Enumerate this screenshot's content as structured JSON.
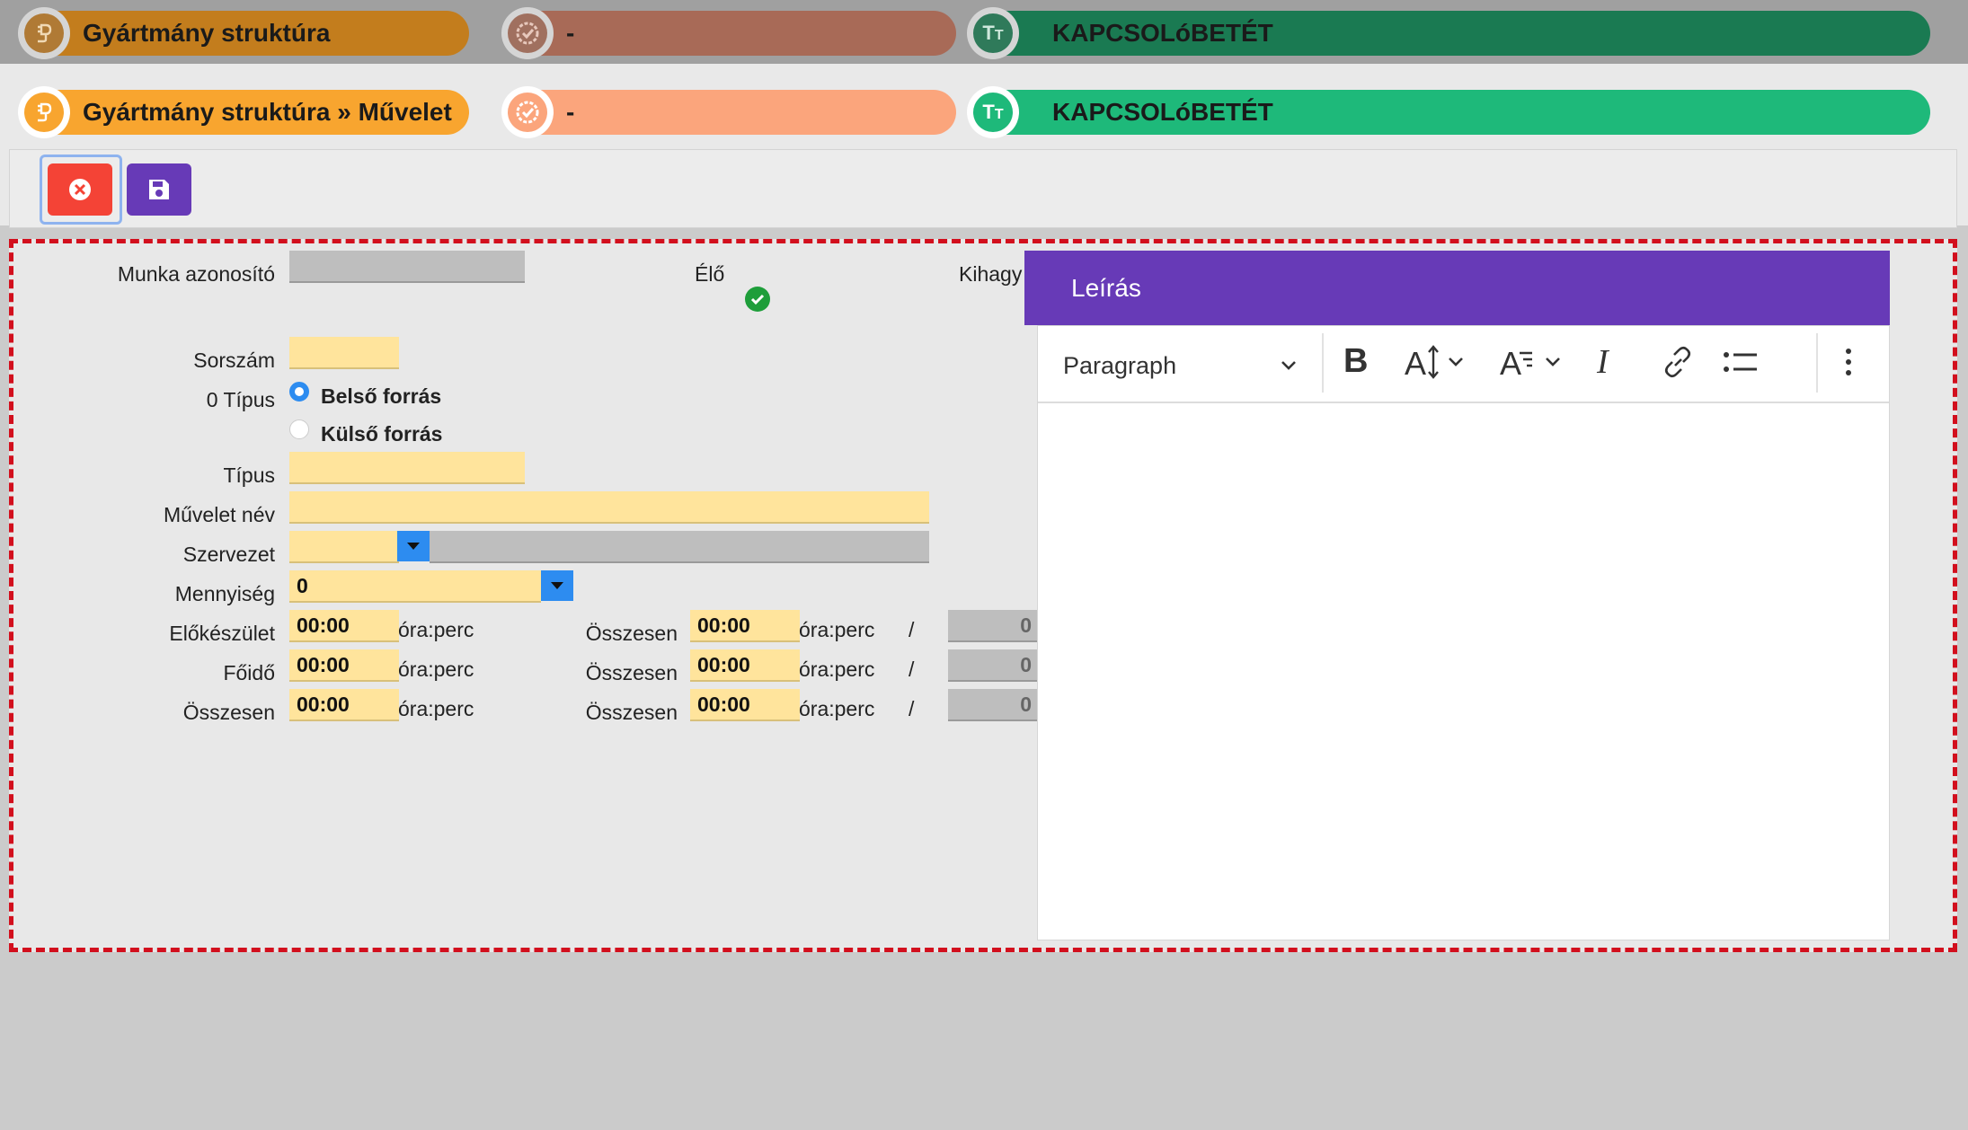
{
  "breadcrumb_top": [
    {
      "label": "Gyártmány struktúra",
      "icon": "plug-icon",
      "color": "#c37d1d"
    },
    {
      "label": "-",
      "icon": "check-badge-icon",
      "color": "#a86a57"
    },
    {
      "label": "KAPCSOLóBETÉT",
      "icon": "text-size-icon",
      "color": "#1a7a52"
    }
  ],
  "breadcrumb_main": [
    {
      "label": "Gyártmány struktúra » Művelet",
      "icon": "plug-icon",
      "color": "#f8a52f"
    },
    {
      "label": "-",
      "icon": "check-badge-icon",
      "color": "#fba57c"
    },
    {
      "label": "KAPCSOLóBETÉT",
      "icon": "text-size-icon",
      "color": "#1eb97a"
    }
  ],
  "toolbar": {
    "close_icon": "close-circle-icon",
    "save_icon": "floppy-disk-icon"
  },
  "form": {
    "munka_azonosito_label": "Munka azonosító",
    "munka_azonosito_value": "",
    "elo_label": "Élő",
    "kihagy_label": "Kihagy",
    "sorszam_label": "Sorszám",
    "sorszam_value": "",
    "tipus0_label": "0 Típus",
    "radio_belso": "Belső forrás",
    "radio_kulso": "Külső forrás",
    "radio_selected": "Belső forrás",
    "tipus_label": "Típus",
    "tipus_value": "",
    "muvelet_nev_label": "Művelet név",
    "muvelet_nev_value": "",
    "szervezet_label": "Szervezet",
    "szervezet_value": "",
    "mennyiseg_label": "Mennyiség",
    "mennyiseg_value": "0",
    "mennyiseg_unit": "",
    "rows": [
      {
        "label": "Előkészület",
        "value": "00:00",
        "unit": "óra:perc",
        "total_label": "Összesen",
        "total_value": "00:00",
        "total_unit": "óra:perc",
        "slash": "/",
        "count": "0"
      },
      {
        "label": "Főidő",
        "value": "00:00",
        "unit": "óra:perc",
        "total_label": "Összesen",
        "total_value": "00:00",
        "total_unit": "óra:perc",
        "slash": "/",
        "count": "0"
      },
      {
        "label": "Összesen",
        "value": "00:00",
        "unit": "óra:perc",
        "total_label": "Összesen",
        "total_value": "00:00",
        "total_unit": "óra:perc",
        "slash": "/",
        "count": "0"
      }
    ]
  },
  "description": {
    "title": "Leírás",
    "paragraph_select": "Paragraph",
    "content": ""
  },
  "colors": {
    "accent_purple": "#673ab7",
    "dropdown_blue": "#2d8cf0",
    "field_yellow": "#ffe49c",
    "dashed_red": "#d20f1d",
    "close_red": "#f44336",
    "save_purple": "#673ab7"
  }
}
